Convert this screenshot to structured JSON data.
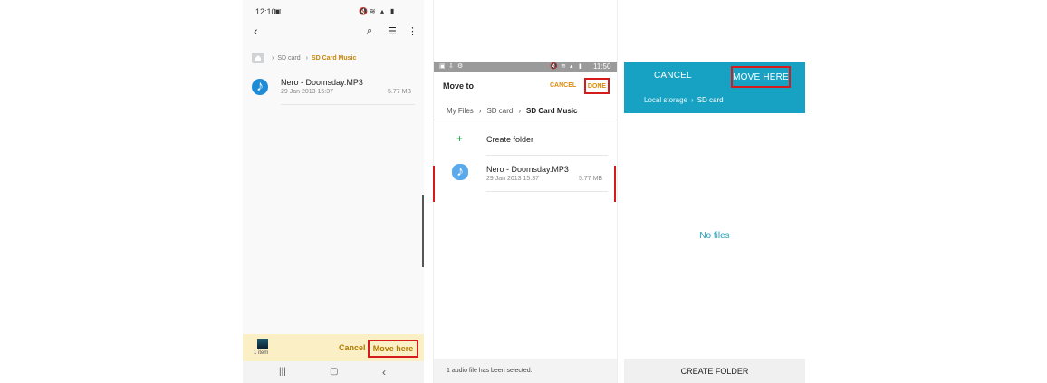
{
  "panel1": {
    "status_time": "12:10",
    "breadcrumb": [
      "SD card",
      "SD Card Music"
    ],
    "file": {
      "name": "Nero - Doomsday.MP3",
      "date": "29 Jan 2013 15:37",
      "size": "5.77 MB"
    },
    "bottom": {
      "items_label": "1 item",
      "cancel": "Cancel",
      "move_here": "Move here"
    }
  },
  "panel2": {
    "status_time": "11:50",
    "title": "Move to",
    "cancel": "CANCEL",
    "done": "DONE",
    "breadcrumb": [
      "My Files",
      "SD card",
      "SD Card Music"
    ],
    "create_folder": "Create folder",
    "file": {
      "name": "Nero - Doomsday.MP3",
      "date": "29 Jan 2013 15:37",
      "size": "5.77 MB"
    },
    "footer": "1 audio file has been selected."
  },
  "panel3": {
    "cancel": "CANCEL",
    "move_here": "MOVE HERE",
    "breadcrumb": [
      "Local storage",
      "SD card"
    ],
    "empty": "No files",
    "create_folder": "CREATE FOLDER"
  },
  "colors": {
    "accent_orange": "#c8860d",
    "highlight_red": "#d51b1b",
    "teal": "#17a2c3",
    "music_blue": "#1e8bd6"
  },
  "icons": [
    "back-arrow-icon",
    "search-icon",
    "list-view-icon",
    "more-vert-icon",
    "folder-home-icon",
    "music-note-icon",
    "recents-icon",
    "home-icon",
    "back-nav-icon",
    "wifi-icon",
    "mute-icon",
    "battery-icon",
    "plus-icon",
    "chevron-right-icon"
  ]
}
